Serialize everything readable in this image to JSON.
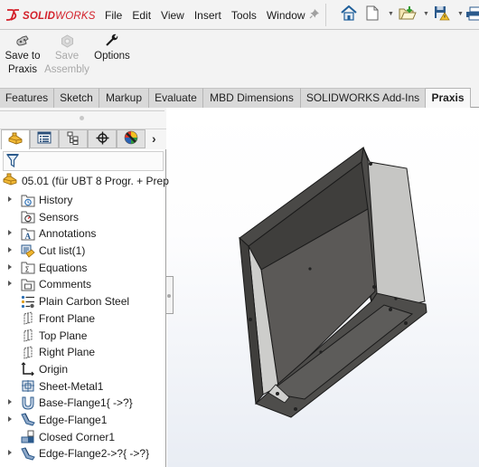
{
  "app": {
    "brand_prefix": "3S",
    "brand_bold": "SOLID",
    "brand_thin": "WORKS",
    "brand_color": "#d3202a"
  },
  "menu": {
    "items": [
      "File",
      "Edit",
      "View",
      "Insert",
      "Tools",
      "Window"
    ],
    "pin_icon": "pin-icon"
  },
  "quick_access": {
    "icons": [
      "home-icon",
      "new-document-icon",
      "open-icon",
      "save-icon",
      "print-icon"
    ]
  },
  "ribbon": {
    "commands": [
      {
        "label_line1": "Save to",
        "label_line2": "Praxis",
        "icon": "save-to-praxis-icon",
        "enabled": true
      },
      {
        "label_line1": "Save",
        "label_line2": "Assembly",
        "icon": "save-assembly-icon",
        "enabled": false
      },
      {
        "label_line1": "Options",
        "label_line2": "",
        "icon": "wrench-icon",
        "enabled": true
      }
    ]
  },
  "tabs": {
    "items": [
      "Features",
      "Sketch",
      "Markup",
      "Evaluate",
      "MBD Dimensions",
      "SOLIDWORKS Add-Ins",
      "Praxis"
    ],
    "active": "Praxis"
  },
  "panel": {
    "tabs": [
      "feature-manager-icon",
      "property-manager-icon",
      "configuration-manager-icon",
      "dimxpert-icon",
      "display-manager-icon"
    ],
    "more_label": "›",
    "filter_icon": "filter-icon",
    "root": {
      "label": "05.01  (für UBT 8 Progr. + Prep",
      "icon": "part-icon"
    },
    "nodes": [
      {
        "label": "History",
        "icon": "history-folder-icon",
        "expandable": true
      },
      {
        "label": "Sensors",
        "icon": "sensors-folder-icon",
        "expandable": false
      },
      {
        "label": "Annotations",
        "icon": "annotations-folder-icon",
        "expandable": true
      },
      {
        "label": "Cut list(1)",
        "icon": "cut-list-icon",
        "expandable": true
      },
      {
        "label": "Equations",
        "icon": "equations-folder-icon",
        "expandable": true
      },
      {
        "label": "Comments",
        "icon": "comments-folder-icon",
        "expandable": true
      },
      {
        "label": "Plain Carbon Steel",
        "icon": "material-icon",
        "expandable": false
      },
      {
        "label": "Front Plane",
        "icon": "plane-icon",
        "expandable": false
      },
      {
        "label": "Top Plane",
        "icon": "plane-icon",
        "expandable": false
      },
      {
        "label": "Right Plane",
        "icon": "plane-icon",
        "expandable": false
      },
      {
        "label": "Origin",
        "icon": "origin-icon",
        "expandable": false
      },
      {
        "label": "Sheet-Metal1",
        "icon": "sheet-metal-icon",
        "expandable": false
      },
      {
        "label": "Base-Flange1{ ->?}",
        "icon": "base-flange-icon",
        "expandable": true
      },
      {
        "label": "Edge-Flange1",
        "icon": "edge-flange-icon",
        "expandable": true
      },
      {
        "label": "Closed Corner1",
        "icon": "closed-corner-icon",
        "expandable": false
      },
      {
        "label": "Edge-Flange2->?{ ->?}",
        "icon": "edge-flange-icon",
        "expandable": true
      }
    ]
  },
  "viewport": {
    "model": "sheet-metal-enclosure-3d-model"
  }
}
